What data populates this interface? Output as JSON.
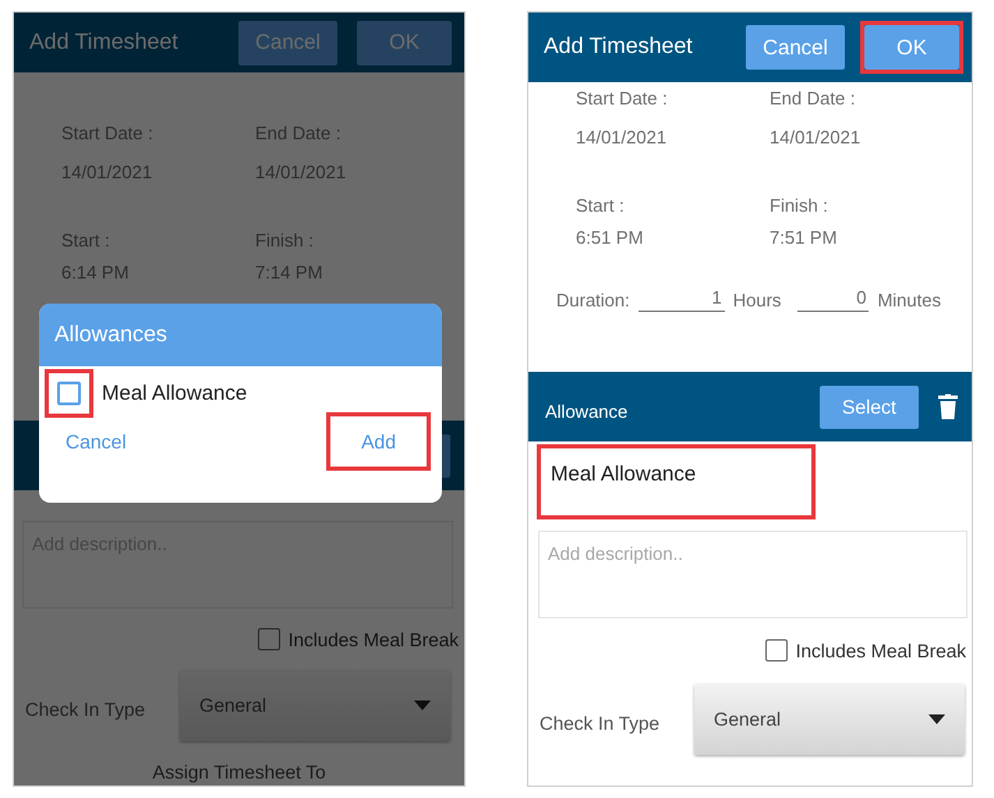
{
  "screens": [
    {
      "dimmed": true,
      "header": {
        "title": "Add Timesheet",
        "buttons": [
          {
            "label": "Cancel",
            "highlighted": false
          },
          {
            "label": "OK",
            "highlighted": false
          }
        ]
      },
      "details": [
        {
          "label": "Start Date :",
          "value": "14/01/2021"
        },
        {
          "label": "End Date :",
          "value": "14/01/2021"
        },
        {
          "label": "Start :",
          "value": "6:14 PM"
        },
        {
          "label": "Finish :",
          "value": "7:14 PM"
        }
      ],
      "description": {
        "placeholder": "Add description.."
      },
      "meal_break": {
        "label": "Includes Meal Break",
        "checked": false
      },
      "check_in": {
        "label": "Check In Type",
        "value": "General"
      },
      "footer": "Assign Timesheet To",
      "dialog": {
        "title": "Allowances",
        "items": [
          {
            "label": "Meal Allowance",
            "checked": false,
            "highlighted": true
          }
        ],
        "actions": [
          {
            "label": "Cancel",
            "highlighted": false
          },
          {
            "label": "Add",
            "highlighted": true
          }
        ]
      }
    },
    {
      "dimmed": false,
      "header": {
        "title": "Add Timesheet",
        "buttons": [
          {
            "label": "Cancel",
            "highlighted": false
          },
          {
            "label": "OK",
            "highlighted": true
          }
        ]
      },
      "details": [
        {
          "label": "Start Date :",
          "value": "14/01/2021"
        },
        {
          "label": "End Date :",
          "value": "14/01/2021"
        },
        {
          "label": "Start :",
          "value": "6:51 PM"
        },
        {
          "label": "Finish :",
          "value": "7:51 PM"
        }
      ],
      "duration": {
        "label": "Duration:",
        "hours": "1",
        "hours_unit": "Hours",
        "minutes": "0",
        "minutes_unit": "Minutes"
      },
      "allowance": {
        "title": "Allowance",
        "button": "Select",
        "name": "Meal Allowance",
        "name_highlighted": true
      },
      "description": {
        "placeholder": "Add description.."
      },
      "meal_break": {
        "label": "Includes Meal Break",
        "checked": false
      },
      "check_in": {
        "label": "Check In Type",
        "value": "General"
      }
    }
  ]
}
